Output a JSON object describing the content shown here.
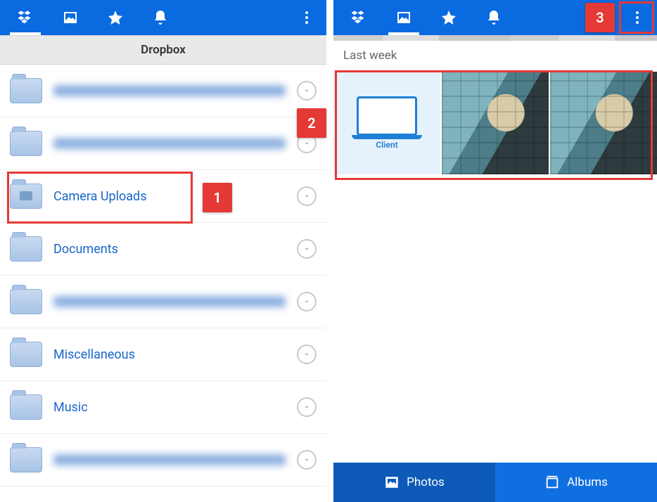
{
  "colors": {
    "accent": "#0a6ae0",
    "callout": "#e53935"
  },
  "left": {
    "header_title": "Dropbox",
    "tabs": [
      {
        "name": "dropbox",
        "active": true
      },
      {
        "name": "photos",
        "active": false
      },
      {
        "name": "favorites",
        "active": false
      },
      {
        "name": "notifications",
        "active": false
      }
    ],
    "folders": [
      {
        "name": "",
        "blurred": true,
        "blur_w": "w1"
      },
      {
        "name": "",
        "blurred": true,
        "blur_w": "w2"
      },
      {
        "name": "Camera Uploads",
        "blurred": false,
        "highlight": true
      },
      {
        "name": "Documents",
        "blurred": false
      },
      {
        "name": "",
        "blurred": true,
        "blur_w": "w3"
      },
      {
        "name": "Miscellaneous",
        "blurred": false
      },
      {
        "name": "Music",
        "blurred": false
      },
      {
        "name": "",
        "blurred": true,
        "blur_w": "w4"
      }
    ]
  },
  "right": {
    "tabs": [
      {
        "name": "dropbox",
        "active": false
      },
      {
        "name": "photos",
        "active": true
      },
      {
        "name": "favorites",
        "active": false
      },
      {
        "name": "notifications",
        "active": false
      }
    ],
    "section_label": "Last week",
    "thumbs": [
      {
        "kind": "client",
        "label": "Client"
      },
      {
        "kind": "art"
      },
      {
        "kind": "art"
      }
    ],
    "bottom_tabs": {
      "photos": "Photos",
      "albums": "Albums",
      "active": "photos"
    }
  },
  "callouts": {
    "c1": "1",
    "c2": "2",
    "c3": "3"
  }
}
